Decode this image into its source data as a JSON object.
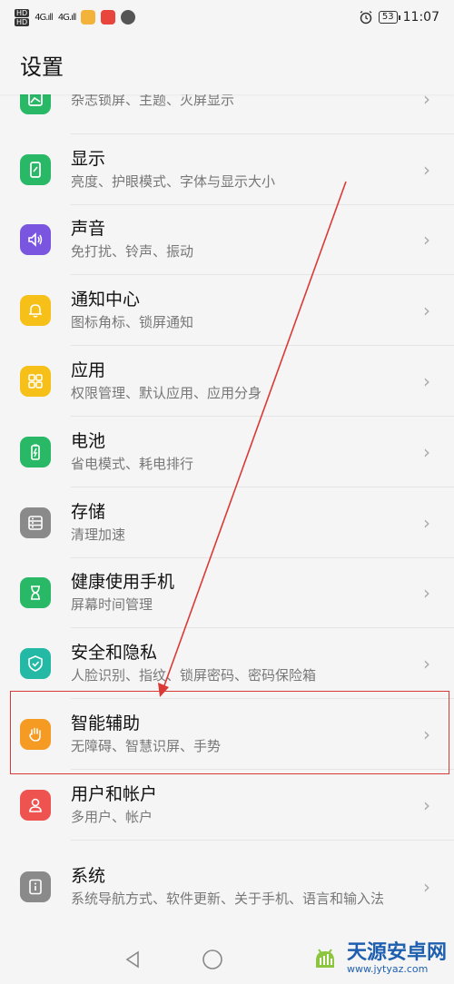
{
  "status_bar": {
    "hd1": "HD",
    "hd2": "HD",
    "signal1": "4G.ıll",
    "signal2": "4G.ıll",
    "battery": "53",
    "time": "11:07"
  },
  "header": {
    "title": "设置"
  },
  "items": [
    {
      "title": "",
      "subtitle": "杂志锁屏、主题、灭屏显示",
      "icon": "image-icon",
      "color": "#29b866"
    },
    {
      "title": "显示",
      "subtitle": "亮度、护眼模式、字体与显示大小",
      "icon": "display-icon",
      "color": "#29b866"
    },
    {
      "title": "声音",
      "subtitle": "免打扰、铃声、振动",
      "icon": "speaker-icon",
      "color": "#7a55e0"
    },
    {
      "title": "通知中心",
      "subtitle": "图标角标、锁屏通知",
      "icon": "bell-icon",
      "color": "#f6c018"
    },
    {
      "title": "应用",
      "subtitle": "权限管理、默认应用、应用分身",
      "icon": "apps-grid-icon",
      "color": "#f6c018"
    },
    {
      "title": "电池",
      "subtitle": "省电模式、耗电排行",
      "icon": "battery-icon",
      "color": "#29b866"
    },
    {
      "title": "存储",
      "subtitle": "清理加速",
      "icon": "storage-icon",
      "color": "#8a8a8a"
    },
    {
      "title": "健康使用手机",
      "subtitle": "屏幕时间管理",
      "icon": "hourglass-icon",
      "color": "#29b866"
    },
    {
      "title": "安全和隐私",
      "subtitle": "人脸识别、指纹、锁屏密码、密码保险箱",
      "icon": "shield-icon",
      "color": "#23b9a5"
    },
    {
      "title": "智能辅助",
      "subtitle": "无障碍、智慧识屏、手势",
      "icon": "hand-icon",
      "color": "#f59a23"
    },
    {
      "title": "用户和帐户",
      "subtitle": "多用户、帐户",
      "icon": "user-icon",
      "color": "#ef5350"
    },
    {
      "title": "系统",
      "subtitle": "系统导航方式、软件更新、关于手机、语言和输入法",
      "icon": "info-icon",
      "color": "#8a8a8a"
    }
  ],
  "chevron": "›",
  "watermark": {
    "name": "天源安卓网",
    "url": "www.jytyaz.com"
  }
}
